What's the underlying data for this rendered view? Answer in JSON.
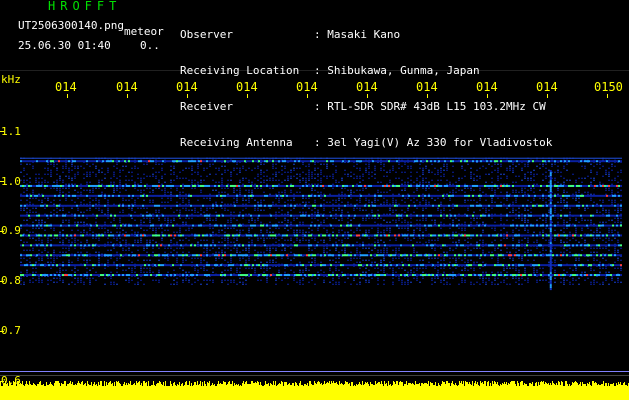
{
  "header": {
    "title": "HROFFT",
    "filename": "UT2506300140.png",
    "tag": "meteor",
    "datetime": "25.06.30 01:40",
    "count": "0..",
    "info": [
      {
        "label": "Observer",
        "value": ": Masaki Kano"
      },
      {
        "label": "Receiving Location",
        "value": ": Shibukawa, Gunma, Japan"
      },
      {
        "label": "Receiver",
        "value": ": RTL-SDR SDR# 43dB L15 103.2MHz CW"
      },
      {
        "label": "Receiving Antenna",
        "value": ": 3el Yagi(V) Az 330 for Vladivostok"
      }
    ]
  },
  "x_axis": {
    "tick_labels": [
      "014",
      "014",
      "014",
      "014",
      "014",
      "014",
      "014",
      "014",
      "014",
      "0150"
    ]
  },
  "y_axis": {
    "unit": "kHz",
    "ticks": [
      "1.1",
      "1.0",
      "0.9",
      "0.8",
      "0.7",
      "0.6"
    ]
  },
  "spectrogram": {
    "colors": {
      "background": "#000000",
      "noise": "#0a20a0",
      "signal_mid": "#20a0ff",
      "signal_high": "#40ff80",
      "peak": "#ff4040",
      "baseline": "#ffff00",
      "tick": "#ffff00"
    },
    "bands_khz": [
      1.04,
      0.99,
      0.97,
      0.95,
      0.93,
      0.91,
      0.89,
      0.87,
      0.85,
      0.83,
      0.81
    ],
    "meteor_event_time_fraction": 0.88
  }
}
